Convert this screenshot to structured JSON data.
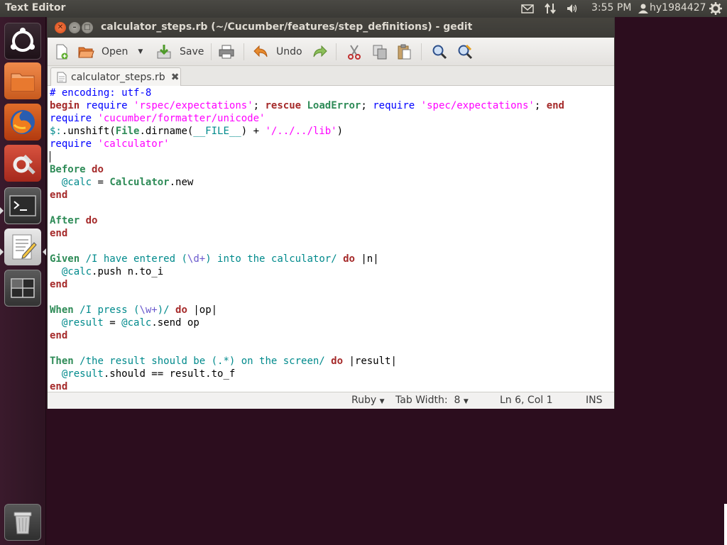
{
  "top_panel": {
    "app_title": "Text Editor",
    "clock": "3:55 PM",
    "user": "hy1984427",
    "icons": [
      "mail-icon",
      "network-arrows-icon",
      "volume-icon",
      "user-icon",
      "gear-icon"
    ]
  },
  "launcher": {
    "items": [
      "ubuntu-home-icon",
      "files-icon",
      "firefox-icon",
      "settings-icon",
      "terminal-icon",
      "text-editor-icon",
      "workspace-switcher-icon",
      "trash-icon"
    ]
  },
  "window": {
    "title": "calculator_steps.rb (~/Cucumber/features/step_definitions) - gedit",
    "buttons": [
      "close",
      "minimize",
      "maximize"
    ]
  },
  "toolbar": {
    "open_label": "Open",
    "save_label": "Save",
    "undo_label": "Undo"
  },
  "tab": {
    "filename": "calculator_steps.rb"
  },
  "editor": {
    "lines": [
      [
        [
          "cmt",
          "# encoding: utf-8"
        ]
      ],
      [
        [
          "kw",
          "begin"
        ],
        [
          "tx",
          " "
        ],
        [
          "cmt",
          "require"
        ],
        [
          "tx",
          " "
        ],
        [
          "str",
          "'rspec/expectations'"
        ],
        [
          "tx",
          "; "
        ],
        [
          "kw",
          "rescue"
        ],
        [
          "tx",
          " "
        ],
        [
          "cst",
          "LoadError"
        ],
        [
          "tx",
          "; "
        ],
        [
          "cmt",
          "require"
        ],
        [
          "tx",
          " "
        ],
        [
          "str",
          "'spec/expectations'"
        ],
        [
          "tx",
          "; "
        ],
        [
          "kw",
          "end"
        ]
      ],
      [
        [
          "cmt",
          "require"
        ],
        [
          "tx",
          " "
        ],
        [
          "str",
          "'cucumber/formatter/unicode'"
        ]
      ],
      [
        [
          "iv",
          "$:"
        ],
        [
          "tx",
          ".unshift("
        ],
        [
          "cst",
          "File"
        ],
        [
          "tx",
          ".dirname("
        ],
        [
          "iv",
          "__FILE__"
        ],
        [
          "tx",
          ") + "
        ],
        [
          "str",
          "'/../../lib'"
        ],
        [
          "tx",
          ")"
        ]
      ],
      [
        [
          "cmt",
          "require"
        ],
        [
          "tx",
          " "
        ],
        [
          "str",
          "'calculator'"
        ]
      ],
      [
        [
          "cursor",
          ""
        ]
      ],
      [
        [
          "cst",
          "Before"
        ],
        [
          "tx",
          " "
        ],
        [
          "kw",
          "do"
        ]
      ],
      [
        [
          "tx",
          "  "
        ],
        [
          "iv",
          "@calc"
        ],
        [
          "tx",
          " = "
        ],
        [
          "cst",
          "Calculator"
        ],
        [
          "tx",
          ".new"
        ]
      ],
      [
        [
          "kw",
          "end"
        ]
      ],
      [
        [
          "tx",
          ""
        ]
      ],
      [
        [
          "cst",
          "After"
        ],
        [
          "tx",
          " "
        ],
        [
          "kw",
          "do"
        ]
      ],
      [
        [
          "kw",
          "end"
        ]
      ],
      [
        [
          "tx",
          ""
        ]
      ],
      [
        [
          "cst",
          "Given"
        ],
        [
          "tx",
          " "
        ],
        [
          "iv",
          "/I have entered ("
        ],
        [
          "ph",
          "\\d+"
        ],
        [
          "iv",
          ") into the calculator/"
        ],
        [
          "tx",
          " "
        ],
        [
          "kw",
          "do"
        ],
        [
          "tx",
          " |n|"
        ]
      ],
      [
        [
          "tx",
          "  "
        ],
        [
          "iv",
          "@calc"
        ],
        [
          "tx",
          ".push n.to_i"
        ]
      ],
      [
        [
          "kw",
          "end"
        ]
      ],
      [
        [
          "tx",
          ""
        ]
      ],
      [
        [
          "cst",
          "When"
        ],
        [
          "tx",
          " "
        ],
        [
          "iv",
          "/I press ("
        ],
        [
          "ph",
          "\\w+"
        ],
        [
          "iv",
          ")/"
        ],
        [
          "tx",
          " "
        ],
        [
          "kw",
          "do"
        ],
        [
          "tx",
          " |op|"
        ]
      ],
      [
        [
          "tx",
          "  "
        ],
        [
          "iv",
          "@result"
        ],
        [
          "tx",
          " = "
        ],
        [
          "iv",
          "@calc"
        ],
        [
          "tx",
          ".send op"
        ]
      ],
      [
        [
          "kw",
          "end"
        ]
      ],
      [
        [
          "tx",
          ""
        ]
      ],
      [
        [
          "cst",
          "Then"
        ],
        [
          "tx",
          " "
        ],
        [
          "iv",
          "/the result should be (.*) on the screen/"
        ],
        [
          "tx",
          " "
        ],
        [
          "kw",
          "do"
        ],
        [
          "tx",
          " |result|"
        ]
      ],
      [
        [
          "tx",
          "  "
        ],
        [
          "iv",
          "@result"
        ],
        [
          "tx",
          ".should == result.to_f"
        ]
      ],
      [
        [
          "kw",
          "end"
        ]
      ]
    ]
  },
  "statusbar": {
    "language": "Ruby",
    "tab_width": "Tab Width:  8",
    "position": "Ln 6, Col 1",
    "mode": "INS"
  }
}
